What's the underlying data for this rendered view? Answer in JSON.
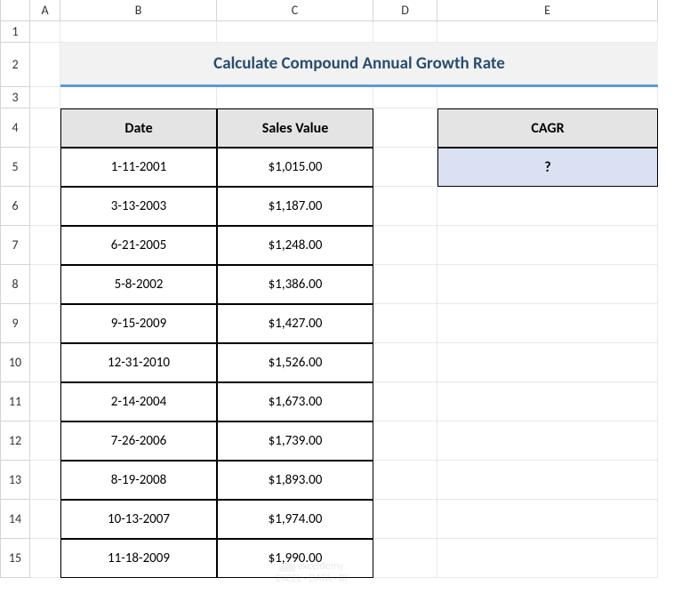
{
  "columns": [
    "",
    "A",
    "B",
    "C",
    "D",
    "E"
  ],
  "rows": [
    "1",
    "2",
    "3",
    "4",
    "5",
    "6",
    "7",
    "8",
    "9",
    "10",
    "11",
    "12",
    "13",
    "14",
    "15"
  ],
  "title": "Calculate Compound Annual Growth Rate",
  "table": {
    "headers": {
      "date": "Date",
      "sales": "Sales Value"
    },
    "data": [
      {
        "date": "1-11-2001",
        "sales": "$1,015.00"
      },
      {
        "date": "3-13-2003",
        "sales": "$1,187.00"
      },
      {
        "date": "6-21-2005",
        "sales": "$1,248.00"
      },
      {
        "date": "5-8-2002",
        "sales": "$1,386.00"
      },
      {
        "date": "9-15-2009",
        "sales": "$1,427.00"
      },
      {
        "date": "12-31-2010",
        "sales": "$1,526.00"
      },
      {
        "date": "2-14-2004",
        "sales": "$1,673.00"
      },
      {
        "date": "7-26-2006",
        "sales": "$1,739.00"
      },
      {
        "date": "8-19-2008",
        "sales": "$1,893.00"
      },
      {
        "date": "10-13-2007",
        "sales": "$1,974.00"
      },
      {
        "date": "11-18-2009",
        "sales": "$1,990.00"
      }
    ]
  },
  "cagr": {
    "header": "CAGR",
    "value": "?"
  },
  "watermark": {
    "brand": "exceldemy",
    "tag": "EXCEL · DATA · BI"
  }
}
